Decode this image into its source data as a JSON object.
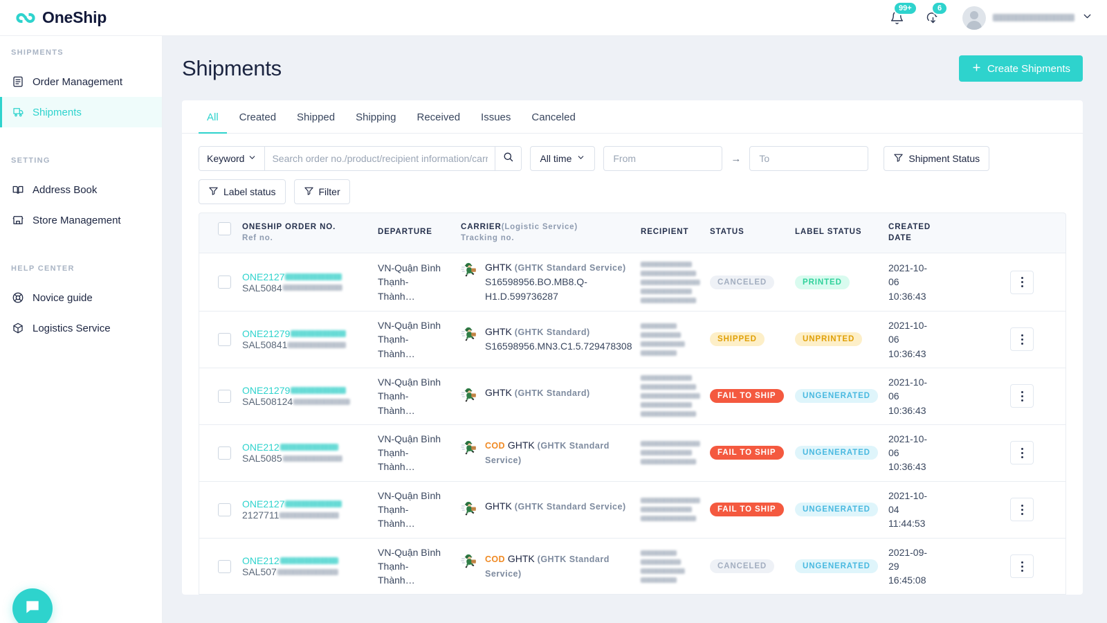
{
  "brand": {
    "name": "OneShip",
    "logo_icon": "oneship-logo-icon",
    "accent": "#2ed3cd"
  },
  "topbar": {
    "notifications": {
      "icon": "bell-icon",
      "badge": "99+"
    },
    "downloads": {
      "icon": "download-cloud-icon",
      "badge": "6"
    },
    "user": {
      "avatar_icon": "avatar-icon",
      "name_redacted": true,
      "chevron_icon": "chevron-down-icon"
    }
  },
  "sidebar": {
    "sections": [
      {
        "label": "SHIPMENTS",
        "items": [
          {
            "label": "Order Management",
            "icon": "clipboard-list-icon",
            "active": false
          },
          {
            "label": "Shipments",
            "icon": "truck-box-icon",
            "active": true
          }
        ]
      },
      {
        "label": "SETTING",
        "items": [
          {
            "label": "Address Book",
            "icon": "open-book-icon",
            "active": false
          },
          {
            "label": "Store Management",
            "icon": "storefront-icon",
            "active": false
          }
        ]
      },
      {
        "label": "HELP CENTER",
        "items": [
          {
            "label": "Novice guide",
            "icon": "lifebuoy-icon",
            "active": false
          },
          {
            "label": "Logistics Service",
            "icon": "package-box-icon",
            "active": false
          }
        ]
      }
    ],
    "chat_widget": {
      "icon": "chat-bubble-icon"
    }
  },
  "main": {
    "title": "Shipments",
    "create_button": {
      "label": "Create Shipments",
      "icon": "plus-icon"
    },
    "tabs": [
      {
        "label": "All",
        "active": true
      },
      {
        "label": "Created",
        "active": false
      },
      {
        "label": "Shipped",
        "active": false
      },
      {
        "label": "Shipping",
        "active": false
      },
      {
        "label": "Received",
        "active": false
      },
      {
        "label": "Issues",
        "active": false
      },
      {
        "label": "Canceled",
        "active": false
      }
    ],
    "filters": {
      "keyword_select": {
        "label": "Keyword",
        "icon": "chevron-down-icon"
      },
      "search": {
        "value": "",
        "placeholder": "Search order no./product/recipient information/carri"
      },
      "search_icon": "search-icon",
      "time_select": {
        "label": "All time",
        "icon": "chevron-down-icon"
      },
      "date_from": {
        "value": "",
        "placeholder": "From"
      },
      "date_to": {
        "value": "",
        "placeholder": "To"
      },
      "range_arrow": "→",
      "shipment_status_button": {
        "label": "Shipment Status",
        "icon": "funnel-icon"
      },
      "label_status_button": {
        "label": "Label status",
        "icon": "funnel-icon"
      },
      "filter_button": {
        "label": "Filter",
        "icon": "funnel-icon"
      }
    },
    "table": {
      "columns": [
        {
          "key": "select",
          "label": "",
          "icon": "checkbox-icon"
        },
        {
          "key": "order",
          "label": "ONESHIP ORDER NO.",
          "sub": "Ref no."
        },
        {
          "key": "departure",
          "label": "DEPARTURE",
          "sub": ""
        },
        {
          "key": "carrier",
          "label": "CARRIER",
          "paren": "(Logistic Service)",
          "sub": "Tracking no."
        },
        {
          "key": "recipient",
          "label": "RECIPIENT",
          "sub": ""
        },
        {
          "key": "status",
          "label": "STATUS",
          "sub": ""
        },
        {
          "key": "label_status",
          "label": "LABEL STATUS",
          "sub": ""
        },
        {
          "key": "created",
          "label": "CREATED",
          "sub": "DATE"
        }
      ],
      "rows": [
        {
          "order_no": "ONE2127",
          "ref_no": "SAL5084",
          "departure": "VN-Quận Bình Thạnh-Thành…",
          "cod": "",
          "carrier": "GHTK",
          "service": "(GHTK Standard Service)",
          "tracking": "S16598956.BO.MB8.Q-H1.D.599736287",
          "recipient_lines": 5,
          "status": "CANCELED",
          "status_style": "p-canceled",
          "label_status": "PRINTED",
          "label_style": "p-printed",
          "created_date": "2021-10-06",
          "created_time": "10:36:43"
        },
        {
          "order_no": "ONE21279",
          "ref_no": "SAL50841",
          "departure": "VN-Quận Bình Thạnh-Thành…",
          "cod": "",
          "carrier": "GHTK",
          "service": "(GHTK Standard)",
          "tracking": "S16598956.MN3.C1.5.729478308",
          "recipient_lines": 4,
          "status": "SHIPPED",
          "status_style": "p-shipped",
          "label_status": "UNPRINTED",
          "label_style": "p-unprinted",
          "created_date": "2021-10-06",
          "created_time": "10:36:43"
        },
        {
          "order_no": "ONE21279",
          "ref_no": "SAL508124",
          "departure": "VN-Quận Bình Thạnh-Thành…",
          "cod": "",
          "carrier": "GHTK",
          "service": "(GHTK Standard)",
          "tracking": "",
          "recipient_lines": 5,
          "status": "FAIL TO SHIP",
          "status_style": "p-fail",
          "label_status": "UNGENERATED",
          "label_style": "p-ungenerated",
          "created_date": "2021-10-06",
          "created_time": "10:36:43"
        },
        {
          "order_no": "ONE212",
          "ref_no": "SAL5085",
          "departure": "VN-Quận Bình Thạnh-Thành…",
          "cod": "COD",
          "carrier": "GHTK",
          "service": "(GHTK Standard Service)",
          "tracking": "",
          "recipient_lines": 3,
          "status": "FAIL TO SHIP",
          "status_style": "p-fail",
          "label_status": "UNGENERATED",
          "label_style": "p-ungenerated",
          "created_date": "2021-10-06",
          "created_time": "10:36:43"
        },
        {
          "order_no": "ONE2127",
          "ref_no": "2127711",
          "departure": "VN-Quận Bình Thạnh-Thành…",
          "cod": "",
          "carrier": "GHTK",
          "service": "(GHTK Standard Service)",
          "tracking": "",
          "recipient_lines": 3,
          "status": "FAIL TO SHIP",
          "status_style": "p-fail",
          "label_status": "UNGENERATED",
          "label_style": "p-ungenerated",
          "created_date": "2021-10-04",
          "created_time": "11:44:53"
        },
        {
          "order_no": "ONE212",
          "ref_no": "SAL507",
          "departure": "VN-Quận Bình Thạnh-Thành…",
          "cod": "COD",
          "carrier": "GHTK",
          "service": "(GHTK Standard Service)",
          "tracking": "",
          "recipient_lines": 4,
          "status": "CANCELED",
          "status_style": "p-canceled",
          "label_status": "UNGENERATED",
          "label_style": "p-ungenerated",
          "created_date": "2021-09-29",
          "created_time": "16:45:08"
        }
      ],
      "row_action_icon": "kebab-menu-icon"
    }
  }
}
